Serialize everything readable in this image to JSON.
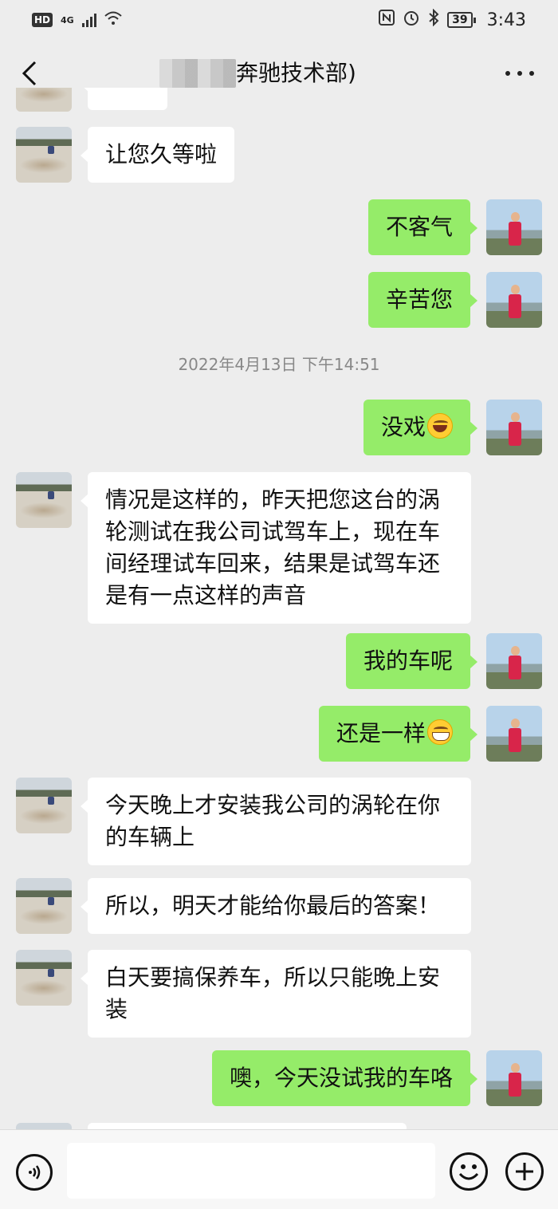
{
  "status_bar": {
    "hd": "HD",
    "network": "4G",
    "battery": "39",
    "time": "3:43"
  },
  "header": {
    "title": "奔驰技术部)"
  },
  "timestamp": "2022年4月13日 下午14:51",
  "messages": [
    {
      "side": "left",
      "text": "让您久等啦"
    },
    {
      "side": "right",
      "text": "不客气"
    },
    {
      "side": "right",
      "text": "辛苦您"
    },
    {
      "side": "right",
      "text": "没戏",
      "emoji": "laugh-cry"
    },
    {
      "side": "left",
      "lines": [
        "情况是这样的，昨天把您这台的涡",
        "轮测试在我公司试驾车上，现在车",
        "间经理试车回来，结果是试驾车还",
        "是有一点这样的声音"
      ]
    },
    {
      "side": "right",
      "text": "我的车呢"
    },
    {
      "side": "right",
      "text": "还是一样",
      "emoji": "grin"
    },
    {
      "side": "left",
      "lines": [
        "今天晚上才安装我公司的涡轮在你",
        "的车辆上"
      ]
    },
    {
      "side": "left",
      "text": "所以，明天才能给你最后的答案！"
    },
    {
      "side": "left",
      "lines": [
        "白天要搞保养车，所以只能晚上安",
        "装"
      ]
    },
    {
      "side": "right",
      "text": "噢，今天没试我的车咯"
    }
  ],
  "input": {
    "placeholder": ""
  }
}
